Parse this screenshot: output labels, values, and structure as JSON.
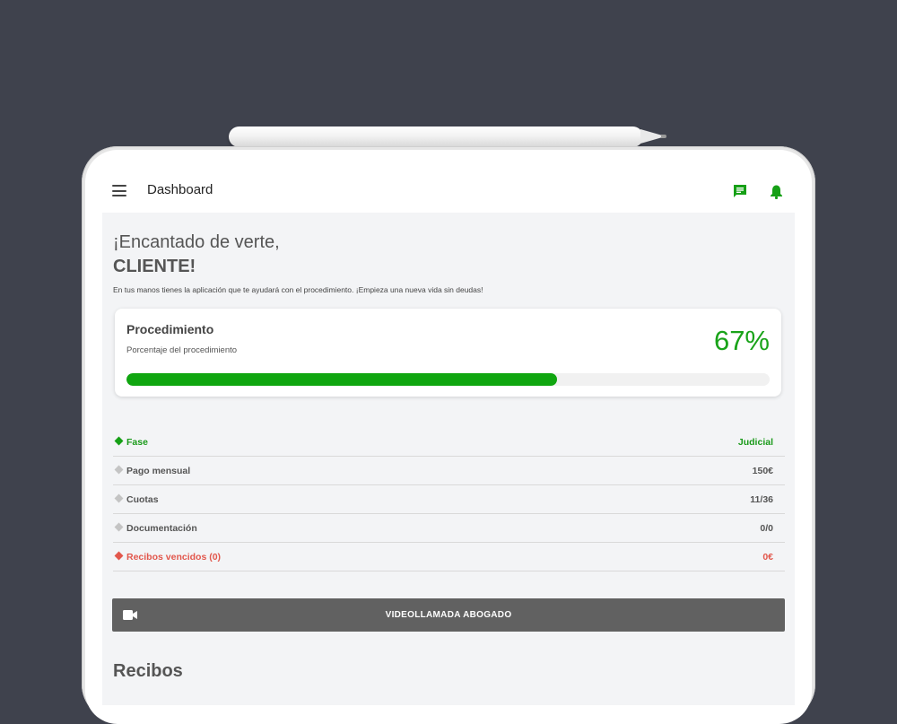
{
  "appbar": {
    "title": "Dashboard",
    "menu_icon": "hamburger-menu-icon",
    "chat_icon": "chat-icon",
    "bell_icon": "bell-icon",
    "accent_color": "#16a016"
  },
  "greeting": {
    "line1": "¡Encantado de verte,",
    "line2": "CLIENTE!",
    "intro": "En tus manos tienes la aplicación que te ayudará con el procedimiento. ¡Empieza una nueva vida sin deudas!"
  },
  "procedure": {
    "title": "Procedimiento",
    "subtitle": "Porcentaje del procedimiento",
    "percent_label": "67%",
    "progress": 0.67
  },
  "info": [
    {
      "label": "Fase",
      "value": "Judicial",
      "status": "green"
    },
    {
      "label": "Pago mensual",
      "value": "150€",
      "status": "neutral"
    },
    {
      "label": "Cuotas",
      "value": "11/36",
      "status": "neutral"
    },
    {
      "label": "Documentación",
      "value": "0/0",
      "status": "neutral"
    },
    {
      "label": "Recibos vencidos (0)",
      "value": "0€",
      "status": "red"
    }
  ],
  "video_call": {
    "label": "VIDEOLLAMADA ABOGADO",
    "icon": "video-camera-icon"
  },
  "receipts_section": {
    "title": "Recibos"
  },
  "colors": {
    "green": "#16a016",
    "red": "#e2574c",
    "button": "#616161"
  }
}
